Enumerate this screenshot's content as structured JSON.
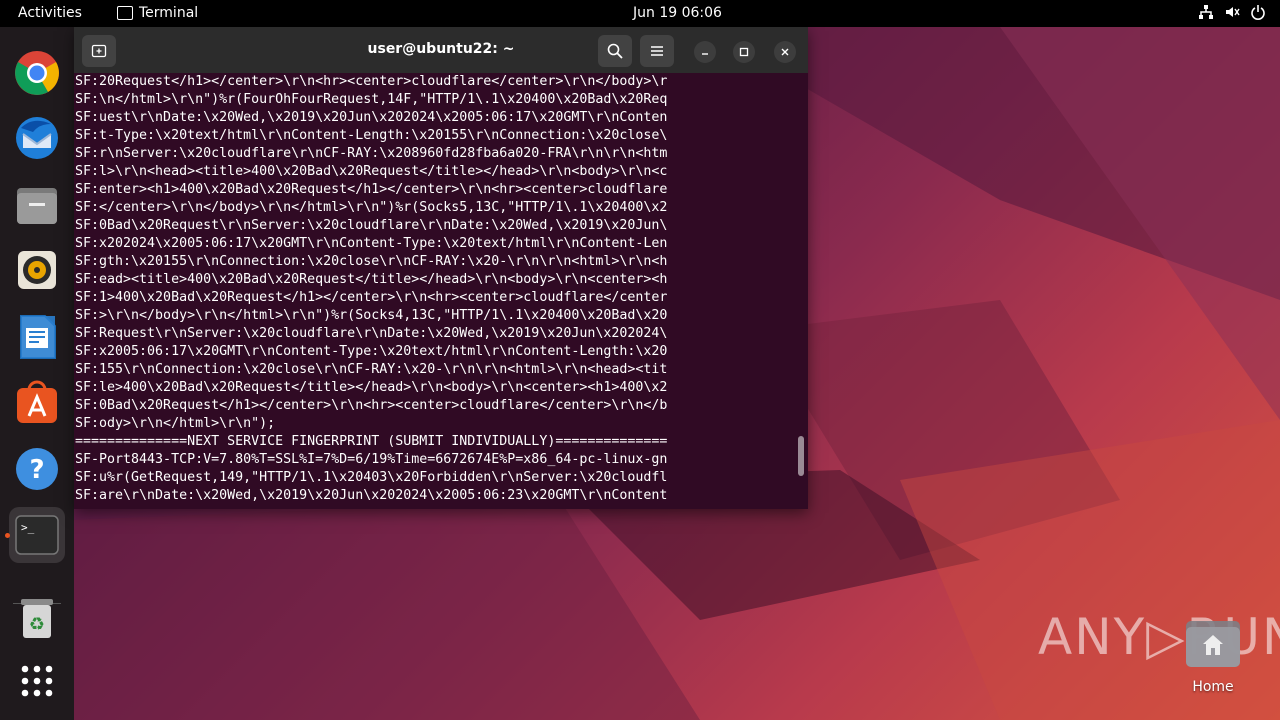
{
  "topbar": {
    "activities": "Activities",
    "app_name": "Terminal",
    "clock": "Jun 19  06:06"
  },
  "window": {
    "title": "user@ubuntu22: ~"
  },
  "terminal": {
    "lines": [
      "SF:20Request</h1></center>\\r\\n<hr><center>cloudflare</center>\\r\\n</body>\\r",
      "SF:\\n</html>\\r\\n\")%r(FourOhFourRequest,14F,\"HTTP/1\\.1\\x20400\\x20Bad\\x20Req",
      "SF:uest\\r\\nDate:\\x20Wed,\\x2019\\x20Jun\\x202024\\x2005:06:17\\x20GMT\\r\\nConten",
      "SF:t-Type:\\x20text/html\\r\\nContent-Length:\\x20155\\r\\nConnection:\\x20close\\",
      "SF:r\\nServer:\\x20cloudflare\\r\\nCF-RAY:\\x208960fd28fba6a020-FRA\\r\\n\\r\\n<htm",
      "SF:l>\\r\\n<head><title>400\\x20Bad\\x20Request</title></head>\\r\\n<body>\\r\\n<c",
      "SF:enter><h1>400\\x20Bad\\x20Request</h1></center>\\r\\n<hr><center>cloudflare",
      "SF:</center>\\r\\n</body>\\r\\n</html>\\r\\n\")%r(Socks5,13C,\"HTTP/1\\.1\\x20400\\x2",
      "SF:0Bad\\x20Request\\r\\nServer:\\x20cloudflare\\r\\nDate:\\x20Wed,\\x2019\\x20Jun\\",
      "SF:x202024\\x2005:06:17\\x20GMT\\r\\nContent-Type:\\x20text/html\\r\\nContent-Len",
      "SF:gth:\\x20155\\r\\nConnection:\\x20close\\r\\nCF-RAY:\\x20-\\r\\n\\r\\n<html>\\r\\n<h",
      "SF:ead><title>400\\x20Bad\\x20Request</title></head>\\r\\n<body>\\r\\n<center><h",
      "SF:1>400\\x20Bad\\x20Request</h1></center>\\r\\n<hr><center>cloudflare</center",
      "SF:>\\r\\n</body>\\r\\n</html>\\r\\n\")%r(Socks4,13C,\"HTTP/1\\.1\\x20400\\x20Bad\\x20",
      "SF:Request\\r\\nServer:\\x20cloudflare\\r\\nDate:\\x20Wed,\\x2019\\x20Jun\\x202024\\",
      "SF:x2005:06:17\\x20GMT\\r\\nContent-Type:\\x20text/html\\r\\nContent-Length:\\x20",
      "SF:155\\r\\nConnection:\\x20close\\r\\nCF-RAY:\\x20-\\r\\n\\r\\n<html>\\r\\n<head><tit",
      "SF:le>400\\x20Bad\\x20Request</title></head>\\r\\n<body>\\r\\n<center><h1>400\\x2",
      "SF:0Bad\\x20Request</h1></center>\\r\\n<hr><center>cloudflare</center>\\r\\n</b",
      "SF:ody>\\r\\n</html>\\r\\n\");",
      "==============NEXT SERVICE FINGERPRINT (SUBMIT INDIVIDUALLY)==============",
      "SF-Port8443-TCP:V=7.80%T=SSL%I=7%D=6/19%Time=6672674E%P=x86_64-pc-linux-gn",
      "SF:u%r(GetRequest,149,\"HTTP/1\\.1\\x20403\\x20Forbidden\\r\\nServer:\\x20cloudfl",
      "SF:are\\r\\nDate:\\x20Wed,\\x2019\\x20Jun\\x202024\\x2005:06:23\\x20GMT\\r\\nContent"
    ]
  },
  "desktop": {
    "home_label": "Home",
    "watermark": "ANY▷RUN"
  },
  "dock": {
    "items": [
      {
        "icon": "chrome-icon"
      },
      {
        "icon": "thunderbird-icon"
      },
      {
        "icon": "files-icon"
      },
      {
        "icon": "rhythmbox-icon"
      },
      {
        "icon": "writer-icon"
      },
      {
        "icon": "app-center-icon"
      },
      {
        "icon": "help-icon"
      },
      {
        "icon": "terminal-icon"
      },
      {
        "icon": "trash-icon"
      },
      {
        "icon": "show-apps-icon"
      }
    ]
  },
  "colors": {
    "terminal_bg": "#300a24",
    "accent": "#e95420",
    "topbar_bg": "#000000"
  }
}
